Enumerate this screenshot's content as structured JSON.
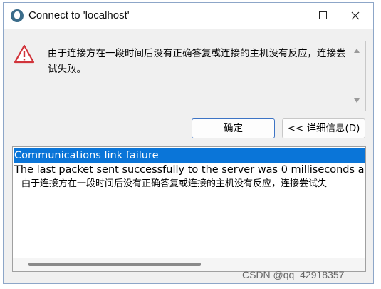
{
  "window": {
    "title": "Connect to 'localhost'",
    "icon": "app-dolphin-icon"
  },
  "message": {
    "icon": "warning-triangle-icon",
    "text": "由于连接方在一段时间后没有正确答复或连接的主机没有反应，连接尝试失败。"
  },
  "buttons": {
    "ok_label": "确定",
    "details_label": "<< 详细信息(D)"
  },
  "details": {
    "lines": [
      "Communications link failure",
      "The last packet sent successfully to the server was 0 milliseconds ag",
      "由于连接方在一段时间后没有正确答复或连接的主机没有反应，连接尝试失"
    ]
  },
  "watermark": "CSDN @qq_42918357",
  "colors": {
    "selection": "#0a75d8",
    "warning": "#d1343b",
    "ok_border": "#3d74c5"
  }
}
